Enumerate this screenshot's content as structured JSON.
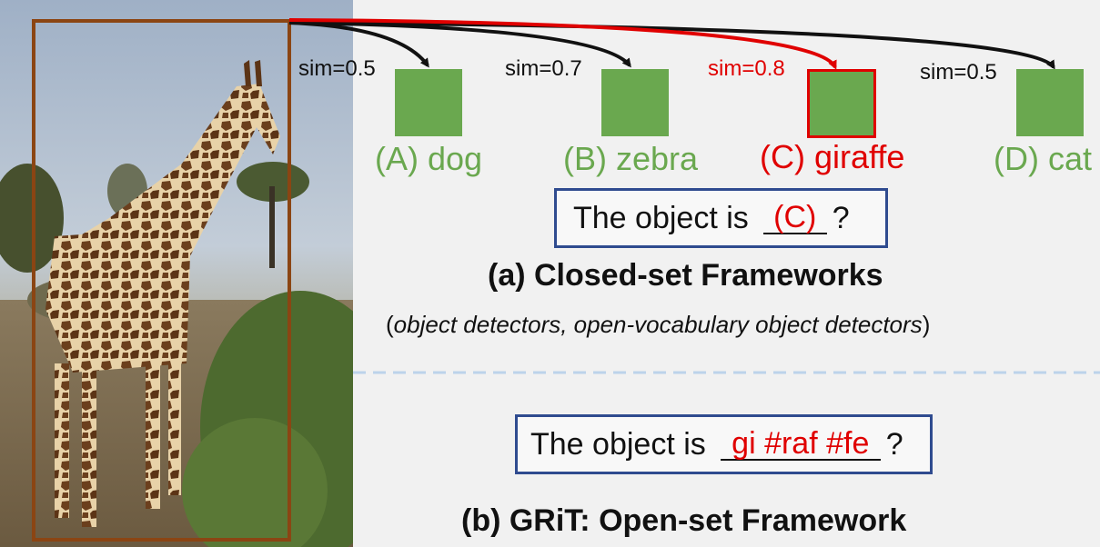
{
  "image_panel": {
    "subject": "giraffe photo with bounding box",
    "box_color": "#8b4513"
  },
  "candidates": [
    {
      "sim": "sim=0.5",
      "label": "(A) dog",
      "highlight": false
    },
    {
      "sim": "sim=0.7",
      "label": "(B) zebra",
      "highlight": false
    },
    {
      "sim": "sim=0.8",
      "label": "(C) giraffe",
      "highlight": true
    },
    {
      "sim": "sim=0.5",
      "label": "(D) cat",
      "highlight": false
    }
  ],
  "closed_set": {
    "prompt_prefix": "The object is",
    "answer": "(C)",
    "prompt_suffix": "?",
    "title": "(a) Closed-set Frameworks",
    "subtitle_open": "(",
    "subtitle_italic": "object detectors, open-vocabulary object detectors",
    "subtitle_close": ")"
  },
  "open_set": {
    "prompt_prefix": "The object is",
    "answer": "gi #raf #fe",
    "prompt_suffix": "?",
    "title": "(b) GRiT: Open-set Framework"
  },
  "colors": {
    "candidate_green": "#6aa84f",
    "highlight_red": "#e00000",
    "box_blue": "#2f4b8f",
    "divider_blue": "#bcd3ea",
    "bbox_brown": "#8b4513"
  }
}
